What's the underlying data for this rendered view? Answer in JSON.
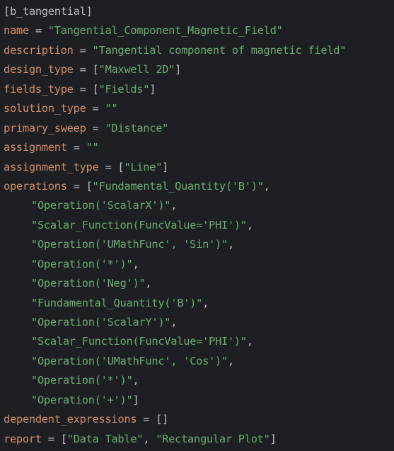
{
  "editor": {
    "lines": [
      {
        "name": "section-header-line",
        "tokens": [
          {
            "t": "section",
            "v": "[b_tangential]"
          }
        ]
      },
      {
        "name": "name-line",
        "tokens": [
          {
            "t": "key",
            "v": "name"
          },
          {
            "t": "punct",
            "v": " = "
          },
          {
            "t": "str",
            "v": "\"Tangential_Component_Magnetic_Field\""
          }
        ]
      },
      {
        "name": "description-line",
        "tokens": [
          {
            "t": "key",
            "v": "description"
          },
          {
            "t": "punct",
            "v": " = "
          },
          {
            "t": "str",
            "v": "\"Tangential component of magnetic field\""
          }
        ]
      },
      {
        "name": "design-type-line",
        "tokens": [
          {
            "t": "key",
            "v": "design_type"
          },
          {
            "t": "punct",
            "v": " = ["
          },
          {
            "t": "str",
            "v": "\"Maxwell 2D\""
          },
          {
            "t": "punct",
            "v": "]"
          }
        ]
      },
      {
        "name": "fields-type-line",
        "tokens": [
          {
            "t": "key",
            "v": "fields_type"
          },
          {
            "t": "punct",
            "v": " = ["
          },
          {
            "t": "str",
            "v": "\"Fields\""
          },
          {
            "t": "punct",
            "v": "]"
          }
        ]
      },
      {
        "name": "solution-type-line",
        "tokens": [
          {
            "t": "key",
            "v": "solution_type"
          },
          {
            "t": "punct",
            "v": " = "
          },
          {
            "t": "str",
            "v": "\"\""
          }
        ]
      },
      {
        "name": "primary-sweep-line",
        "tokens": [
          {
            "t": "key",
            "v": "primary_sweep"
          },
          {
            "t": "punct",
            "v": " = "
          },
          {
            "t": "str",
            "v": "\"Distance\""
          }
        ]
      },
      {
        "name": "assignment-line",
        "tokens": [
          {
            "t": "key",
            "v": "assignment"
          },
          {
            "t": "punct",
            "v": " = "
          },
          {
            "t": "str",
            "v": "\"\""
          }
        ]
      },
      {
        "name": "assignment-type-line",
        "tokens": [
          {
            "t": "key",
            "v": "assignment_type"
          },
          {
            "t": "punct",
            "v": " = ["
          },
          {
            "t": "str",
            "v": "\"Line\""
          },
          {
            "t": "punct",
            "v": "]"
          }
        ]
      },
      {
        "name": "operations-line",
        "tokens": [
          {
            "t": "key",
            "v": "operations"
          },
          {
            "t": "punct",
            "v": " = ["
          },
          {
            "t": "str",
            "v": "\"Fundamental_Quantity('B')\""
          },
          {
            "t": "punct",
            "v": ","
          }
        ]
      },
      {
        "name": "operations-item-line",
        "indent": true,
        "tokens": [
          {
            "t": "str",
            "v": "\"Operation('ScalarX')\""
          },
          {
            "t": "punct",
            "v": ","
          }
        ]
      },
      {
        "name": "operations-item-line",
        "indent": true,
        "tokens": [
          {
            "t": "str",
            "v": "\"Scalar_Function(FuncValue='PHI')\""
          },
          {
            "t": "punct",
            "v": ","
          }
        ]
      },
      {
        "name": "operations-item-line",
        "indent": true,
        "tokens": [
          {
            "t": "str",
            "v": "\"Operation('UMathFunc', 'Sin')\""
          },
          {
            "t": "punct",
            "v": ","
          }
        ]
      },
      {
        "name": "operations-item-line",
        "indent": true,
        "tokens": [
          {
            "t": "str",
            "v": "\"Operation('*')\""
          },
          {
            "t": "punct",
            "v": ","
          }
        ]
      },
      {
        "name": "operations-item-line",
        "indent": true,
        "tokens": [
          {
            "t": "str",
            "v": "\"Operation('Neg')\""
          },
          {
            "t": "punct",
            "v": ","
          }
        ]
      },
      {
        "name": "operations-item-line",
        "indent": true,
        "tokens": [
          {
            "t": "str",
            "v": "\"Fundamental_Quantity('B')\""
          },
          {
            "t": "punct",
            "v": ","
          }
        ]
      },
      {
        "name": "operations-item-line",
        "indent": true,
        "tokens": [
          {
            "t": "str",
            "v": "\"Operation('ScalarY')\""
          },
          {
            "t": "punct",
            "v": ","
          }
        ]
      },
      {
        "name": "operations-item-line",
        "indent": true,
        "tokens": [
          {
            "t": "str",
            "v": "\"Scalar_Function(FuncValue='PHI')\""
          },
          {
            "t": "punct",
            "v": ","
          }
        ]
      },
      {
        "name": "operations-item-line",
        "indent": true,
        "tokens": [
          {
            "t": "str",
            "v": "\"Operation('UMathFunc', 'Cos')\""
          },
          {
            "t": "punct",
            "v": ","
          }
        ]
      },
      {
        "name": "operations-item-line",
        "indent": true,
        "tokens": [
          {
            "t": "str",
            "v": "\"Operation('*')\""
          },
          {
            "t": "punct",
            "v": ","
          }
        ]
      },
      {
        "name": "operations-item-line",
        "indent": true,
        "tokens": [
          {
            "t": "str",
            "v": "\"Operation('+')\""
          },
          {
            "t": "punct",
            "v": "]"
          }
        ]
      },
      {
        "name": "dependent-expressions-line",
        "tokens": [
          {
            "t": "key",
            "v": "dependent_expressions"
          },
          {
            "t": "punct",
            "v": " = []"
          }
        ]
      },
      {
        "name": "report-line",
        "tokens": [
          {
            "t": "key",
            "v": "report"
          },
          {
            "t": "punct",
            "v": " = ["
          },
          {
            "t": "str",
            "v": "\"Data Table\""
          },
          {
            "t": "punct",
            "v": ", "
          },
          {
            "t": "str",
            "v": "\"Rectangular Plot\""
          },
          {
            "t": "punct",
            "v": "]"
          }
        ]
      }
    ]
  },
  "colors": {
    "background": "#1e1f22",
    "key": "#cf8e6d",
    "string": "#6aab73",
    "punctuation": "#bcbec4"
  }
}
